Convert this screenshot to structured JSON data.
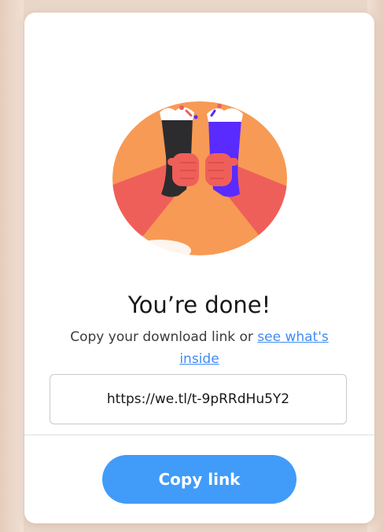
{
  "dialog": {
    "illustration_icon": "cheers-glasses-icon",
    "title": "You’re done!",
    "subtitle_prefix": "Copy your download link or ",
    "subtitle_link": "see what's inside",
    "link_value": "https://we.tl/t-9pRRdHu5Y2",
    "copy_button_label": "Copy link"
  },
  "colors": {
    "accent": "#409cf8",
    "illustration_bg": "#f79a55",
    "link": "#3f8cf5",
    "arm": "#ef5f5a",
    "glass_dark": "#2c2c2e",
    "glass_purple": "#5a2bff"
  }
}
